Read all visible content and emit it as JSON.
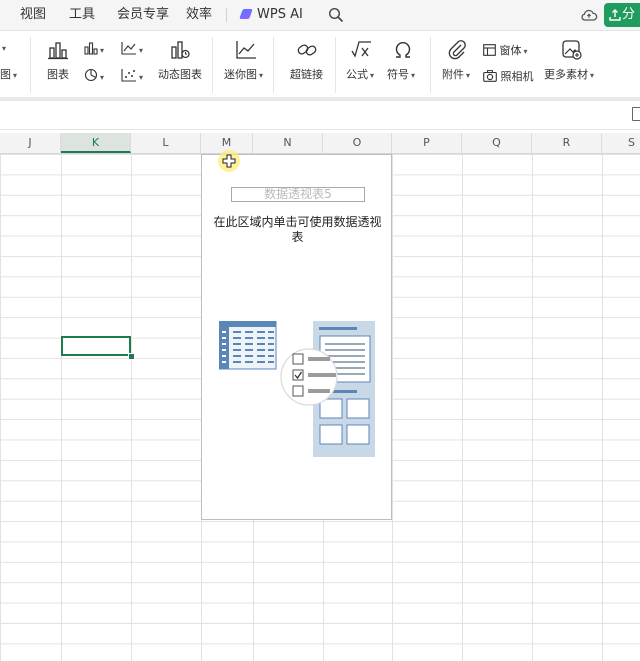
{
  "menubar": {
    "items": [
      "视图",
      "工具",
      "会员专享",
      "效率"
    ],
    "wps_ai": "WPS AI",
    "share_label": "分"
  },
  "ribbon": {
    "chart": "图表",
    "dynamic_chart": "动态图表",
    "sparkline": "迷你图",
    "hyperlink": "超链接",
    "formula": "公式",
    "symbol": "符号",
    "window": "窗体",
    "attachment": "附件",
    "camera": "照相机",
    "more_materials": "更多素材",
    "left_partial_label": "图"
  },
  "columns": [
    "J",
    "K",
    "L",
    "M",
    "N",
    "O",
    "P",
    "Q",
    "R",
    "S"
  ],
  "active_column": "K",
  "pivot": {
    "title": "数据透视表5",
    "hint": "在此区域内单击可使用数据透视表"
  },
  "colors": {
    "accent_green": "#1f7a4f",
    "share_green": "#1f9c5e",
    "illustration_blue": "#5b86b8"
  }
}
